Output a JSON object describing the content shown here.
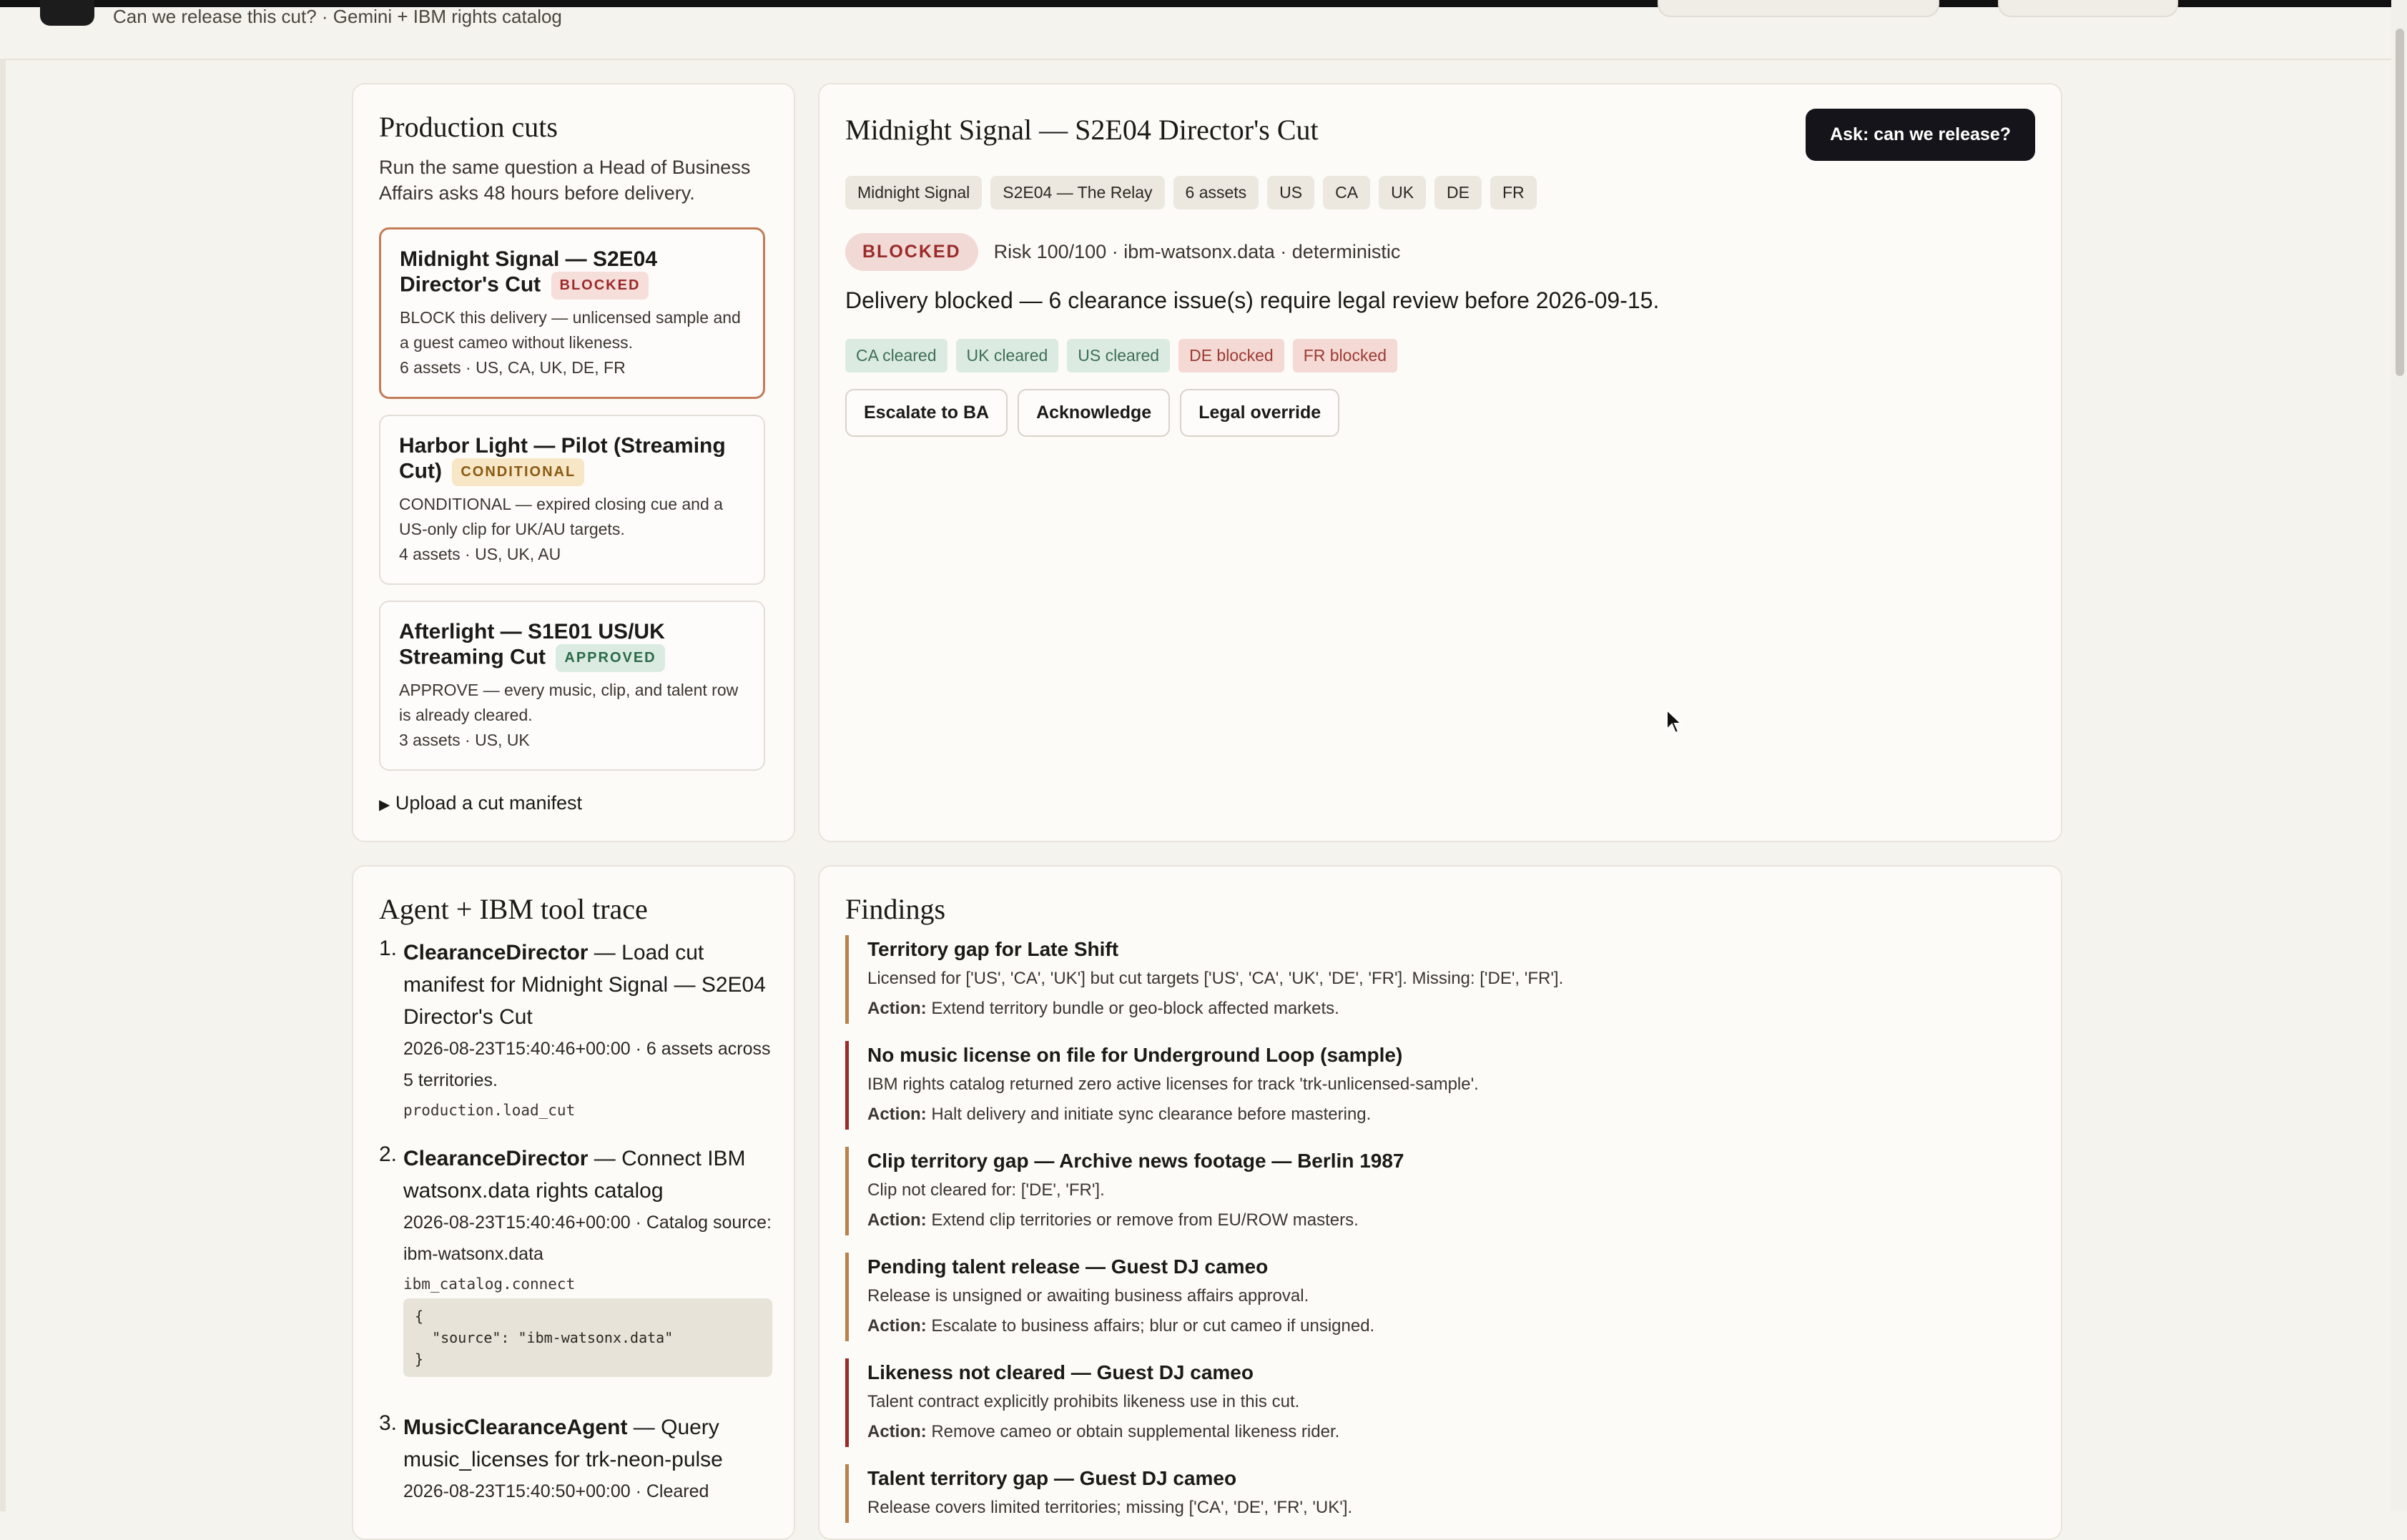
{
  "header": {
    "subtitle": "Can we release this cut? · Gemini + IBM rights catalog"
  },
  "cuts_panel": {
    "title": "Production cuts",
    "description": "Run the same question a Head of Business Affairs asks 48 hours before delivery.",
    "cuts": [
      {
        "title": "Midnight Signal — S2E04 Director's Cut",
        "badge": "BLOCKED",
        "desc": "BLOCK this delivery — unlicensed sample and a guest cameo without likeness.",
        "meta": "6 assets · US, CA, UK, DE, FR",
        "selected": true
      },
      {
        "title": "Harbor Light — Pilot (Streaming Cut)",
        "badge": "CONDITIONAL",
        "desc": "CONDITIONAL — expired closing cue and a US-only clip for UK/AU targets.",
        "meta": "4 assets · US, UK, AU",
        "selected": false
      },
      {
        "title": "Afterlight — S1E01 US/UK Streaming Cut",
        "badge": "APPROVED",
        "desc": "APPROVE — every music, clip, and talent row is already cleared.",
        "meta": "3 assets · US, UK",
        "selected": false
      }
    ],
    "upload_label": "Upload a cut manifest"
  },
  "detail": {
    "title": "Midnight Signal — S2E04 Director's Cut",
    "ask_button": "Ask: can we release?",
    "tags": [
      "Midnight Signal",
      "S2E04 — The Relay",
      "6 assets",
      "US",
      "CA",
      "UK",
      "DE",
      "FR"
    ],
    "status": "BLOCKED",
    "risk_line": "Risk 100/100 · ibm-watsonx.data · deterministic",
    "summary": "Delivery blocked — 6 clearance issue(s) require legal review before 2026-09-15.",
    "territories": [
      {
        "label": "CA cleared",
        "state": "cleared"
      },
      {
        "label": "UK cleared",
        "state": "cleared"
      },
      {
        "label": "US cleared",
        "state": "cleared"
      },
      {
        "label": "DE blocked",
        "state": "blocked"
      },
      {
        "label": "FR blocked",
        "state": "blocked"
      }
    ],
    "actions": [
      "Escalate to BA",
      "Acknowledge",
      "Legal override"
    ]
  },
  "trace": {
    "title": "Agent + IBM tool trace",
    "items": [
      {
        "num": "1.",
        "agent": "ClearanceDirector",
        "text": " — Load cut manifest for Midnight Signal — S2E04 Director's Cut",
        "meta": "2026-08-23T15:40:46+00:00 · 6 assets across 5 territories.",
        "code": "production.load_cut"
      },
      {
        "num": "2.",
        "agent": "ClearanceDirector",
        "text": " — Connect IBM watsonx.data rights catalog",
        "meta": "2026-08-23T15:40:46+00:00 · Catalog source: ibm-watsonx.data",
        "code": "ibm_catalog.connect",
        "json": "{\n  \"source\": \"ibm-watsonx.data\"\n}"
      },
      {
        "num": "3.",
        "agent": "MusicClearanceAgent",
        "text": " — Query music_licenses for trk-neon-pulse",
        "meta": "2026-08-23T15:40:50+00:00 · Cleared"
      }
    ]
  },
  "findings": {
    "title": "Findings",
    "action_label": "Action:",
    "items": [
      {
        "title": "Territory gap for Late Shift",
        "body": "Licensed for ['US', 'CA', 'UK'] but cut targets ['US', 'CA', 'UK', 'DE', 'FR']. Missing: ['DE', 'FR'].",
        "action": "Extend territory bundle or geo-block affected markets.",
        "severity": "warn"
      },
      {
        "title": "No music license on file for Underground Loop (sample)",
        "body": "IBM rights catalog returned zero active licenses for track 'trk-unlicensed-sample'.",
        "action": "Halt delivery and initiate sync clearance before mastering.",
        "severity": "block"
      },
      {
        "title": "Clip territory gap — Archive news footage — Berlin 1987",
        "body": "Clip not cleared for: ['DE', 'FR'].",
        "action": "Extend clip territories or remove from EU/ROW masters.",
        "severity": "warn"
      },
      {
        "title": "Pending talent release — Guest DJ cameo",
        "body": "Release is unsigned or awaiting business affairs approval.",
        "action": "Escalate to business affairs; blur or cut cameo if unsigned.",
        "severity": "warn"
      },
      {
        "title": "Likeness not cleared — Guest DJ cameo",
        "body": "Talent contract explicitly prohibits likeness use in this cut.",
        "action": "Remove cameo or obtain supplemental likeness rider.",
        "severity": "block"
      },
      {
        "title": "Talent territory gap — Guest DJ cameo",
        "body": "Release covers limited territories; missing ['CA', 'DE', 'FR', 'UK'].",
        "action": "",
        "severity": "warn"
      }
    ]
  },
  "colors": {
    "accent_selected": "#c37c57",
    "blocked": "#9b2a2a",
    "warning_border": "#b6844b",
    "dark_button": "#14141a"
  }
}
